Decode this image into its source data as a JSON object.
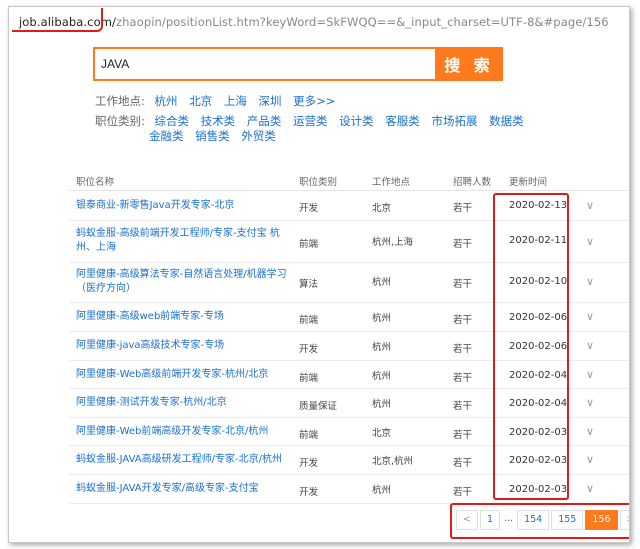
{
  "url": {
    "host": "job.alibaba.com/",
    "path": "zhaopin/positionList.htm?keyWord=SkFWQQ==&_input_charset=UTF-8&#page/156"
  },
  "search": {
    "value": "JAVA",
    "button_label": "搜 索"
  },
  "filters": {
    "location_label": "工作地点:",
    "locations": [
      "杭州",
      "北京",
      "上海",
      "深圳",
      "更多>>"
    ],
    "category_label": "职位类别:",
    "categories_line1": [
      "综合类",
      "技术类",
      "产品类",
      "运营类",
      "设计类",
      "客服类",
      "市场拓展",
      "数据类"
    ],
    "categories_line2": [
      "金融类",
      "销售类",
      "外贸类"
    ]
  },
  "table": {
    "headers": {
      "title": "职位名称",
      "category": "职位类别",
      "location": "工作地点",
      "count": "招聘人数",
      "updated": "更新时间"
    },
    "rows": [
      {
        "title": "银泰商业-新零售Java开发专家-北京",
        "category": "开发",
        "location": "北京",
        "count": "若干",
        "date": "2020-02-13"
      },
      {
        "title": "蚂蚁金服-高级前端开发工程师/专家-支付宝 杭州、上海",
        "category": "前端",
        "location": "杭州,上海",
        "count": "若干",
        "date": "2020-02-11"
      },
      {
        "title": "阿里健康-高级算法专家-自然语言处理/机器学习（医疗方向）",
        "category": "算法",
        "location": "杭州",
        "count": "若干",
        "date": "2020-02-10"
      },
      {
        "title": "阿里健康-高级web前端专家-专场",
        "category": "前端",
        "location": "杭州",
        "count": "若干",
        "date": "2020-02-06"
      },
      {
        "title": "阿里健康-java高级技术专家-专场",
        "category": "开发",
        "location": "杭州",
        "count": "若干",
        "date": "2020-02-06"
      },
      {
        "title": "阿里健康-Web高级前端开发专家-杭州/北京",
        "category": "前端",
        "location": "杭州",
        "count": "若干",
        "date": "2020-02-04"
      },
      {
        "title": "阿里健康-测试开发专家-杭州/北京",
        "category": "质量保证",
        "location": "杭州",
        "count": "若干",
        "date": "2020-02-04"
      },
      {
        "title": "阿里健康-Web前端高级开发专家-北京/杭州",
        "category": "前端",
        "location": "北京",
        "count": "若干",
        "date": "2020-02-03"
      },
      {
        "title": "蚂蚁金服-JAVA高级研发工程师/专家-北京/杭州",
        "category": "开发",
        "location": "北京,杭州",
        "count": "若干",
        "date": "2020-02-03"
      },
      {
        "title": "蚂蚁金服-JAVA开发专家/高级专家-支付宝",
        "category": "开发",
        "location": "杭州",
        "count": "若干",
        "date": "2020-02-03"
      }
    ]
  },
  "pagination": {
    "prev": "<",
    "first": "1",
    "dots": "...",
    "p1": "154",
    "p2": "155",
    "current": "156",
    "next": ">"
  },
  "colors": {
    "accent": "#ff7a1c",
    "link": "#1a6fd0",
    "highlight": "#e01b1b"
  }
}
